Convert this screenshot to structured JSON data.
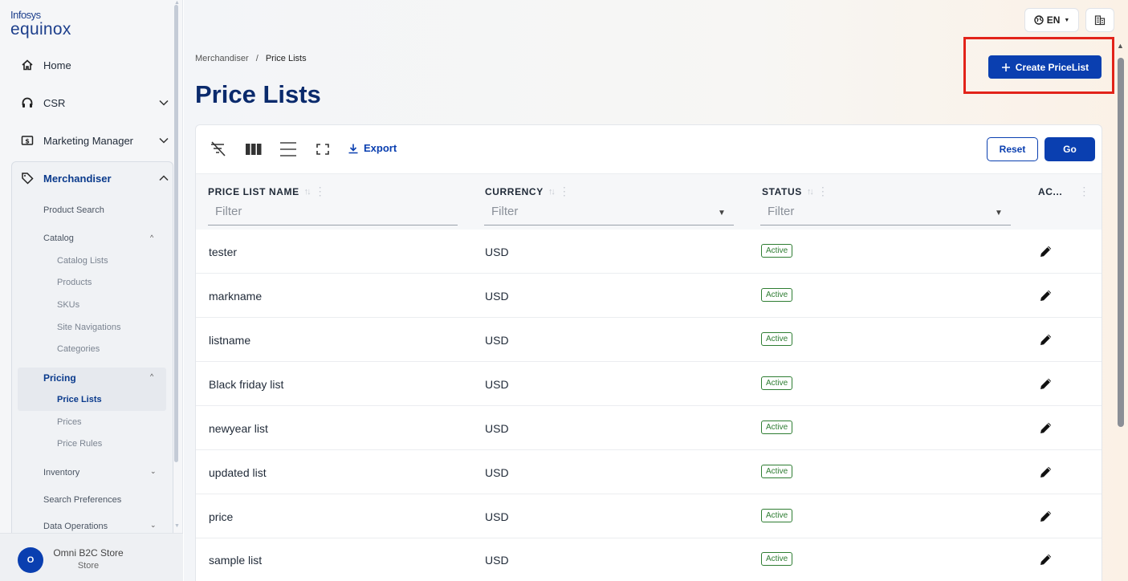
{
  "brand": {
    "line1": "Infosys",
    "line2": "equinox"
  },
  "sidebar": {
    "items": [
      {
        "label": "Home",
        "icon": "home-icon"
      },
      {
        "label": "CSR",
        "icon": "headset-icon"
      },
      {
        "label": "Marketing Manager",
        "icon": "dollar-box-icon"
      }
    ],
    "merchandiser": {
      "label": "Merchandiser",
      "icon": "tag-icon",
      "product_search": "Product Search",
      "catalog": {
        "label": "Catalog",
        "items": [
          "Catalog Lists",
          "Products",
          "SKUs",
          "Site Navigations",
          "Categories"
        ]
      },
      "pricing": {
        "label": "Pricing",
        "items": [
          "Price Lists",
          "Prices",
          "Price Rules"
        ],
        "active": "Price Lists"
      },
      "inventory": "Inventory",
      "search_preferences": "Search Preferences",
      "data_operations": "Data Operations"
    },
    "store": {
      "avatar": "O",
      "name": "Omni B2C Store",
      "type": "Store"
    }
  },
  "topbar": {
    "language": "EN",
    "language_icon": "globe-icon",
    "org_icon": "building-icon"
  },
  "breadcrumb": {
    "parent": "Merchandiser",
    "separator": "/",
    "current": "Price Lists"
  },
  "page": {
    "title": "Price Lists",
    "create_button": "Create PriceList"
  },
  "toolbar": {
    "icons": [
      "clear-filter-icon",
      "columns-icon",
      "density-icon",
      "fullscreen-icon"
    ],
    "export": "Export",
    "reset": "Reset",
    "go": "Go"
  },
  "table": {
    "columns": [
      {
        "label": "PRICE LIST NAME",
        "filter": "Filter"
      },
      {
        "label": "CURRENCY",
        "filter": "Filter"
      },
      {
        "label": "STATUS",
        "filter": "Filter"
      },
      {
        "label": "AC..."
      }
    ],
    "rows": [
      {
        "name": "tester",
        "currency": "USD",
        "status": "Active"
      },
      {
        "name": "markname",
        "currency": "USD",
        "status": "Active"
      },
      {
        "name": "listname",
        "currency": "USD",
        "status": "Active"
      },
      {
        "name": "Black friday list",
        "currency": "USD",
        "status": "Active"
      },
      {
        "name": "newyear list",
        "currency": "USD",
        "status": "Active"
      },
      {
        "name": "updated list",
        "currency": "USD",
        "status": "Active"
      },
      {
        "name": "price",
        "currency": "USD",
        "status": "Active"
      },
      {
        "name": "sample list",
        "currency": "USD",
        "status": "Active"
      }
    ]
  },
  "colors": {
    "primary": "#0a3fb0",
    "title": "#0a2a6c",
    "active_badge": "#2e7d32",
    "highlight_frame": "#e2231a"
  }
}
